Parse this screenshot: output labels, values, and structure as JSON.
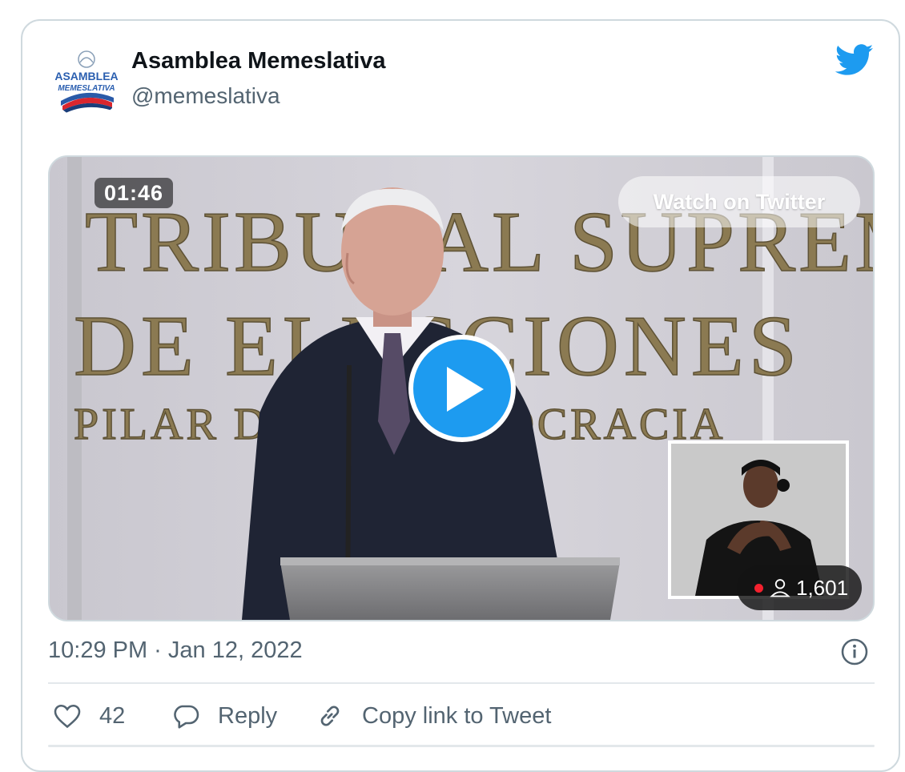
{
  "author": {
    "name": "Asamblea Memeslativa",
    "handle": "@memeslativa",
    "avatar_text_top": "ASAMBLEA",
    "avatar_text_bottom": "MEMESLATIVA"
  },
  "video": {
    "duration": "01:46",
    "watch_label": "Watch on Twitter",
    "viewer_count": "1,601",
    "backdrop_lines": [
      "TRIBUNAL SUPREMO",
      "DE ELECCIONES",
      "PILAR DE LA DEMOCRACIA"
    ]
  },
  "tweet": {
    "timestamp": "10:29 PM · Jan 12, 2022"
  },
  "actions": {
    "like_count": "42",
    "reply_label": "Reply",
    "copy_label": "Copy link to Tweet"
  },
  "colors": {
    "twitter_blue": "#1d9bf0",
    "text_primary": "#0f1419",
    "text_secondary": "#536471",
    "border": "#cfd9de"
  },
  "icons": [
    "twitter-bird-icon",
    "play-icon",
    "info-icon",
    "heart-icon",
    "reply-bubble-icon",
    "link-icon",
    "person-icon",
    "live-dot-icon"
  ]
}
